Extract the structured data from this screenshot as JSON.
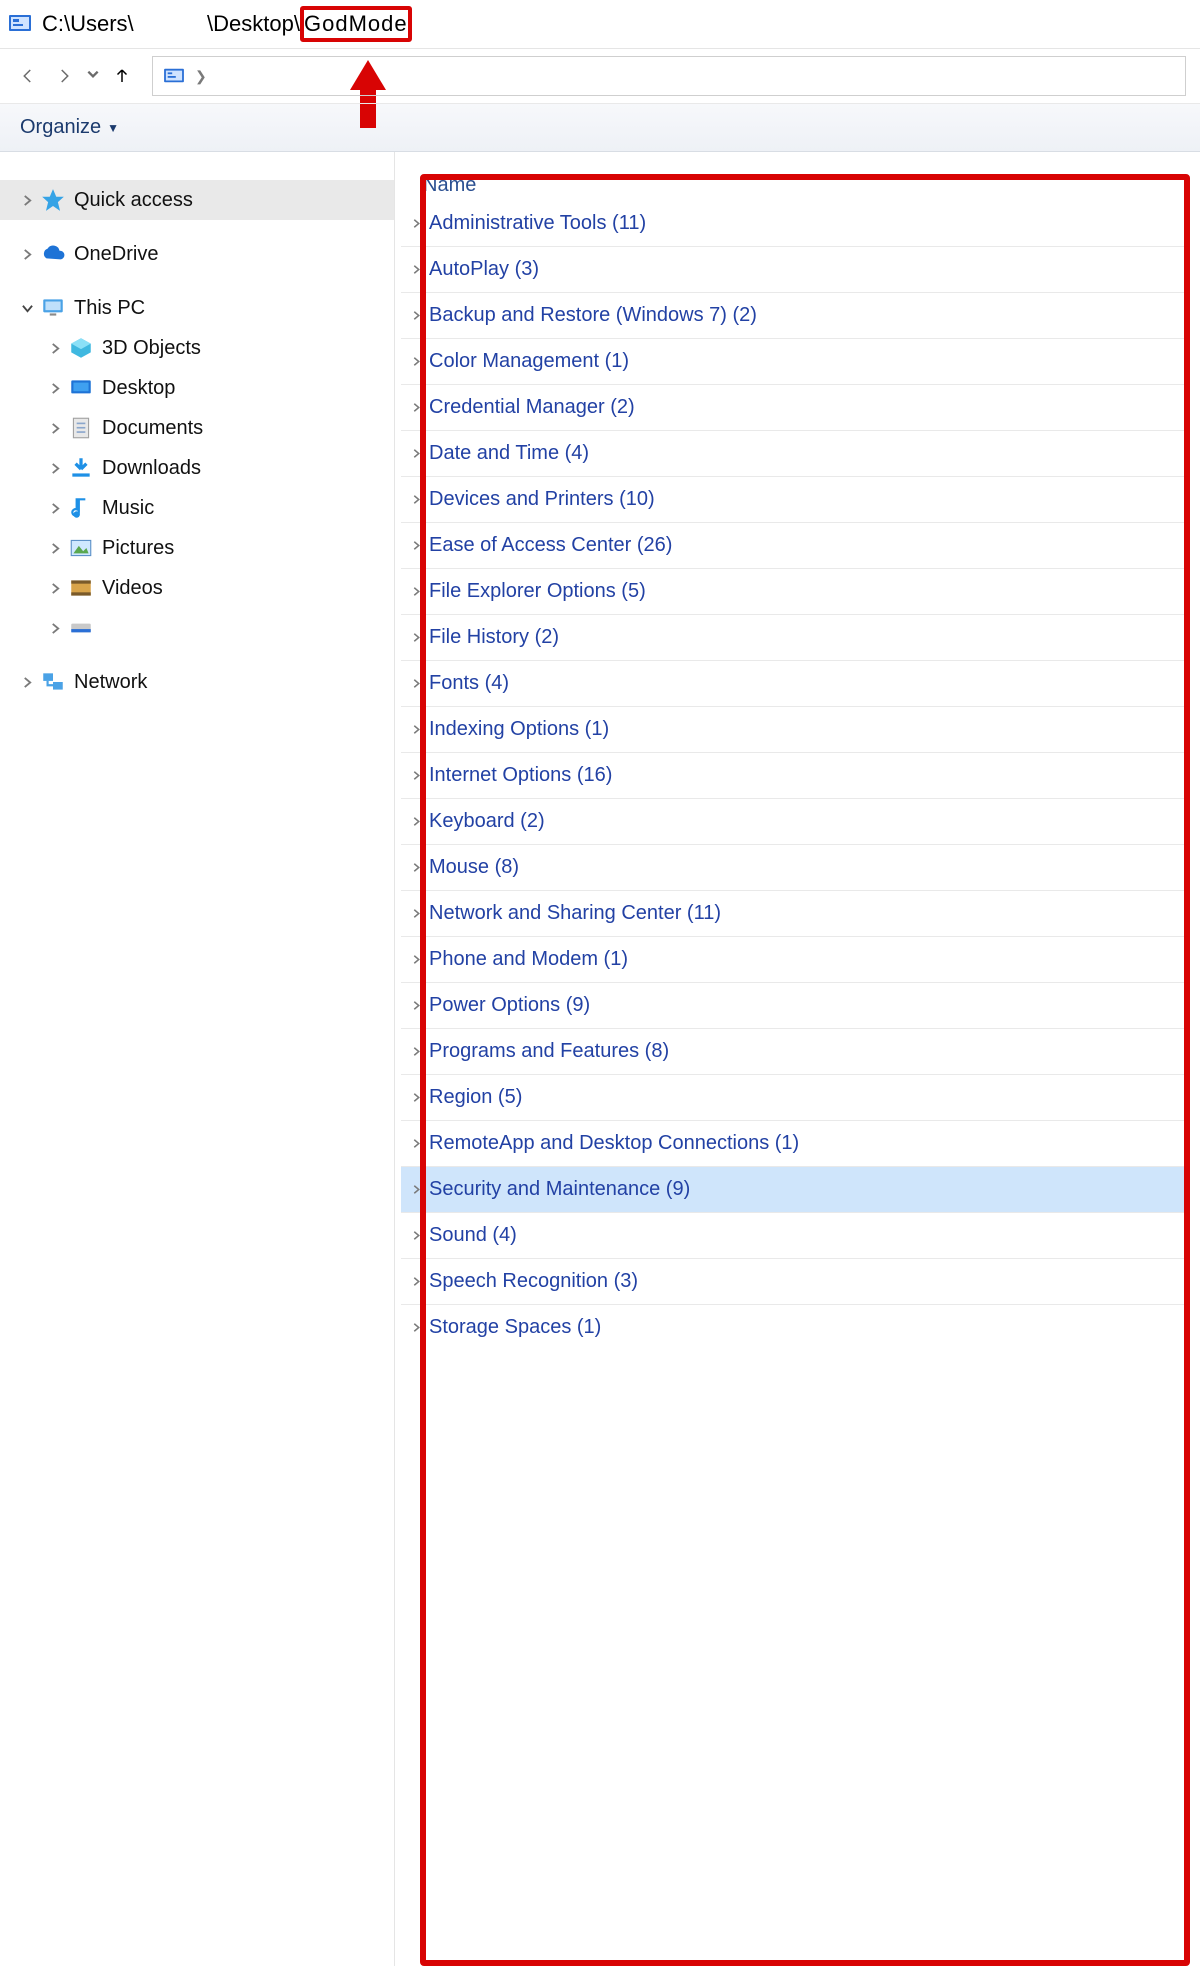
{
  "title": {
    "prefix": "C:\\Users\\",
    "gap": "            ",
    "mid": "\\Desktop\\",
    "folder": "GodMode"
  },
  "commandbar": {
    "organize": "Organize"
  },
  "tree": {
    "quick_access": "Quick access",
    "onedrive": "OneDrive",
    "this_pc": "This PC",
    "children": [
      "3D Objects",
      "Desktop",
      "Documents",
      "Downloads",
      "Music",
      "Pictures",
      "Videos",
      ""
    ],
    "network": "Network"
  },
  "content": {
    "column": "Name",
    "items": [
      "Administrative Tools (11)",
      "AutoPlay (3)",
      "Backup and Restore (Windows 7) (2)",
      "Color Management (1)",
      "Credential Manager (2)",
      "Date and Time (4)",
      "Devices and Printers (10)",
      "Ease of Access Center (26)",
      "File Explorer Options (5)",
      "File History (2)",
      "Fonts (4)",
      "Indexing Options (1)",
      "Internet Options (16)",
      "Keyboard (2)",
      "Mouse (8)",
      "Network and Sharing Center (11)",
      "Phone and Modem (1)",
      "Power Options (9)",
      "Programs and Features (8)",
      "Region (5)",
      "RemoteApp and Desktop Connections (1)",
      "Security and Maintenance (9)",
      "Sound (4)",
      "Speech Recognition (3)",
      "Storage Spaces (1)"
    ],
    "selected_index": 21
  }
}
